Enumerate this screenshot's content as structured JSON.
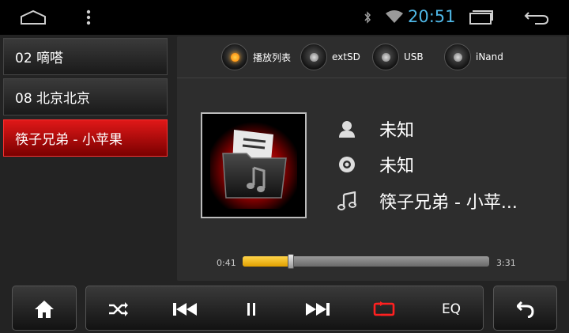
{
  "status": {
    "time": "20:51",
    "icons": [
      "android-home-outline-icon",
      "overflow-menu-icon",
      "bluetooth-icon",
      "wifi-icon",
      "recent-apps-icon",
      "back-icon"
    ]
  },
  "playlist": [
    {
      "label": "02 嘀嗒",
      "active": false
    },
    {
      "label": "08 北京北京",
      "active": false
    },
    {
      "label": "筷子兄弟 - 小苹果",
      "active": true
    }
  ],
  "sources": [
    {
      "label": "播放列表",
      "active": true
    },
    {
      "label": "extSD",
      "active": false
    },
    {
      "label": "USB",
      "active": false
    },
    {
      "label": "iNand",
      "active": false
    }
  ],
  "track": {
    "artist": "未知",
    "album": "未知",
    "title": "筷子兄弟 - 小苹...",
    "elapsed": "0:41",
    "duration": "3:31",
    "progress": 0.195
  },
  "controls": {
    "eq_label": "EQ",
    "icons": [
      "home-icon",
      "shuffle-icon",
      "previous-icon",
      "pause-icon",
      "next-icon",
      "repeat-icon",
      "back-arrow-icon"
    ],
    "repeat_color": "#ff2020"
  },
  "colors": {
    "accent": "#4fb7e6",
    "progress": "#f2b400",
    "highlight": "#c80000"
  }
}
